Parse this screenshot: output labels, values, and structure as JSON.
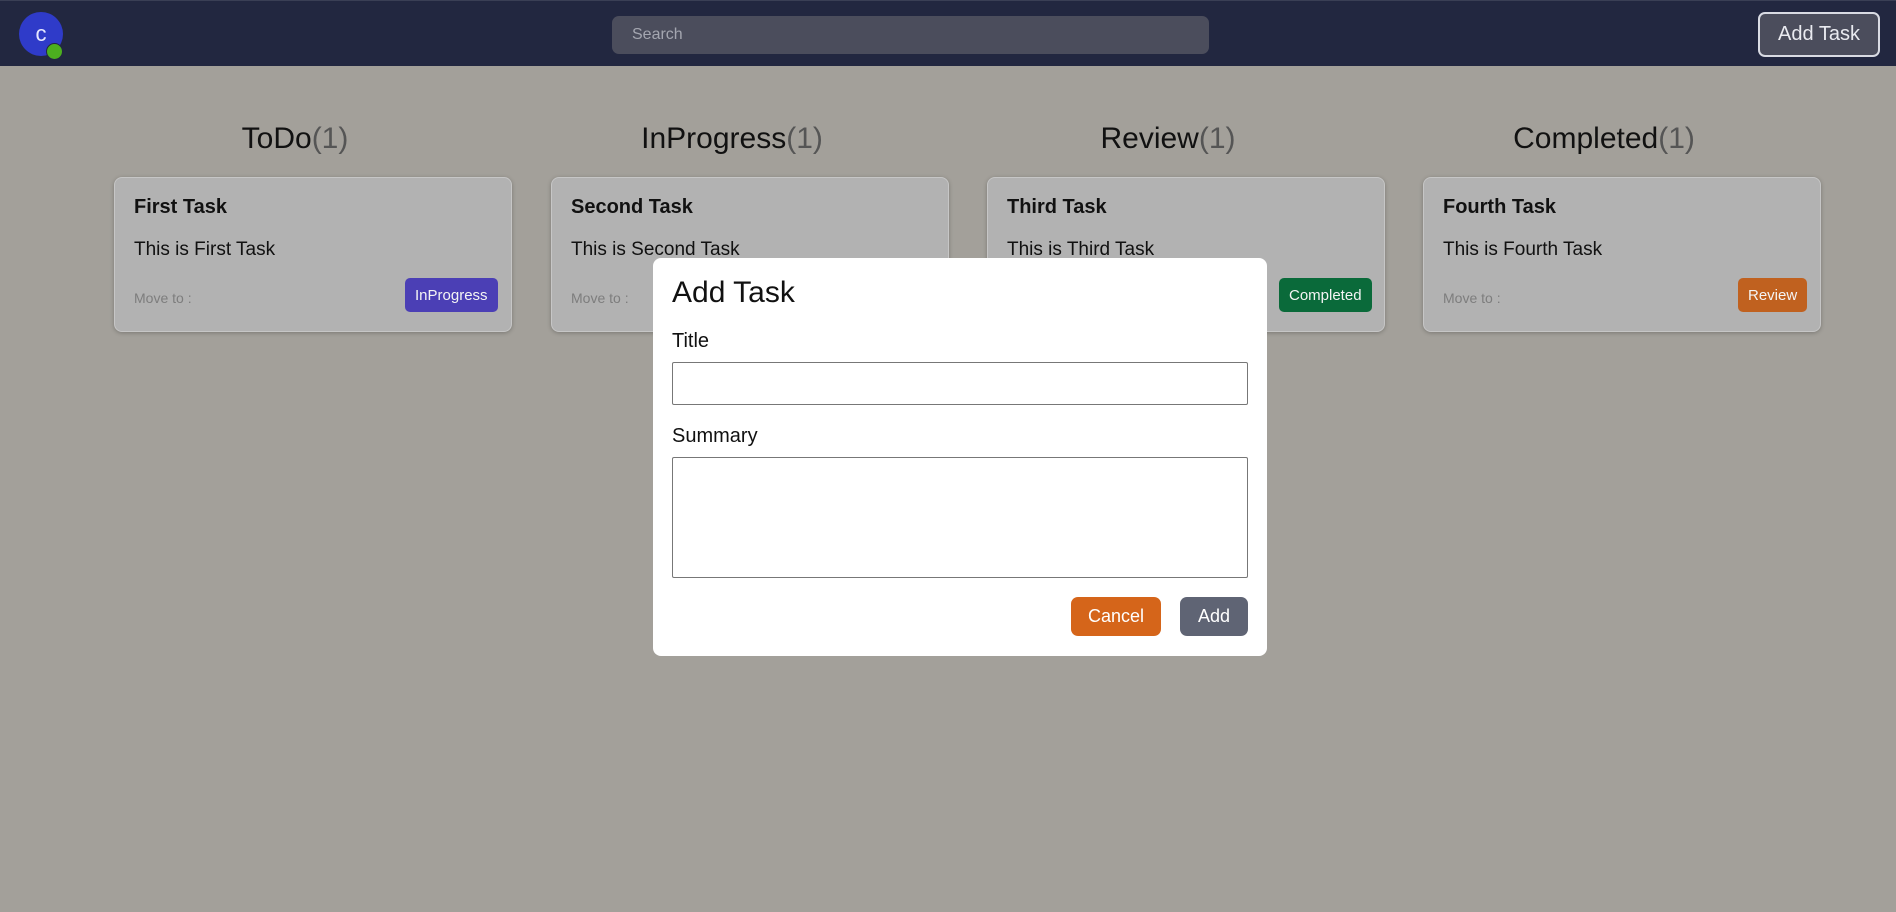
{
  "header": {
    "avatar_letter": "c",
    "search_placeholder": "Search",
    "add_task_label": "Add Task"
  },
  "columns": [
    {
      "title": "ToDo",
      "count": "(1)"
    },
    {
      "title": "InProgress",
      "count": "(1)"
    },
    {
      "title": "Review",
      "count": "(1)"
    },
    {
      "title": "Completed",
      "count": "(1)"
    }
  ],
  "cards": [
    {
      "title": "First Task",
      "summary": "This is First Task",
      "move_label": "Move to :",
      "buttons": [
        "InProgress"
      ]
    },
    {
      "title": "Second Task",
      "summary": "This is Second Task",
      "move_label": "Move to :",
      "buttons": []
    },
    {
      "title": "Third Task",
      "summary": "This is Third Task",
      "move_label": "",
      "buttons": [
        "Completed"
      ]
    },
    {
      "title": "Fourth Task",
      "summary": "This is Fourth Task",
      "move_label": "Move to :",
      "buttons": [
        "Review"
      ]
    }
  ],
  "modal": {
    "title": "Add Task",
    "title_label": "Title",
    "title_value": "",
    "summary_label": "Summary",
    "summary_value": "",
    "cancel_label": "Cancel",
    "add_label": "Add"
  },
  "colors": {
    "header_bg": "#222740",
    "page_bg": "#a3a09a",
    "inprogress_btn": "#4b3fb5",
    "completed_btn": "#0a6a3a",
    "review_btn": "#c0611f",
    "cancel_btn": "#d5651a",
    "add_btn": "#5f6474"
  }
}
